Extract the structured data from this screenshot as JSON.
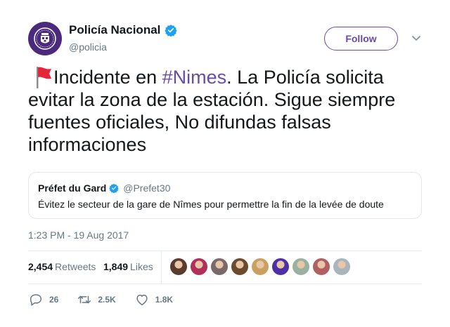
{
  "user": {
    "display_name": "Policía Nacional",
    "handle": "@policia",
    "verified": true,
    "avatar_icon": "policia-crest-icon",
    "avatar_color": "#4b2a7e"
  },
  "follow": {
    "label": "Follow",
    "color": "#6a4aa8"
  },
  "tweet": {
    "emoji": "🚩",
    "text_before": "Incidente en ",
    "hashtag": "#Nimes",
    "text_after": ". La Policía solicita evitar la zona de la estación. Sigue siempre fuentes oficiales, No difundas falsas informaciones"
  },
  "quote": {
    "name": "Préfet du Gard",
    "handle": "@Prefet30",
    "verified": true,
    "text": "Évitez le secteur de la gare de Nîmes pour permettre la fin de la levée de doute"
  },
  "timestamp": "1:23 PM - 19 Aug 2017",
  "stats": {
    "retweets": {
      "count": "2,454",
      "label": "Retweets"
    },
    "likes": {
      "count": "1,849",
      "label": "Likes"
    },
    "liker_avatars": [
      {
        "color": "#5a3b2e"
      },
      {
        "color": "#b0305a"
      },
      {
        "color": "#7a6a6a"
      },
      {
        "color": "#6b4a2e"
      },
      {
        "color": "#c9a060"
      },
      {
        "color": "#4d2fa6"
      },
      {
        "color": "#9ab0a0"
      },
      {
        "color": "#b06060"
      },
      {
        "color": "#aab4bd"
      }
    ]
  },
  "actions": {
    "reply": {
      "icon": "reply-icon",
      "count": "26"
    },
    "retweet": {
      "icon": "retweet-icon",
      "count": "2.5K"
    },
    "like": {
      "icon": "heart-icon",
      "count": "1.8K"
    }
  }
}
